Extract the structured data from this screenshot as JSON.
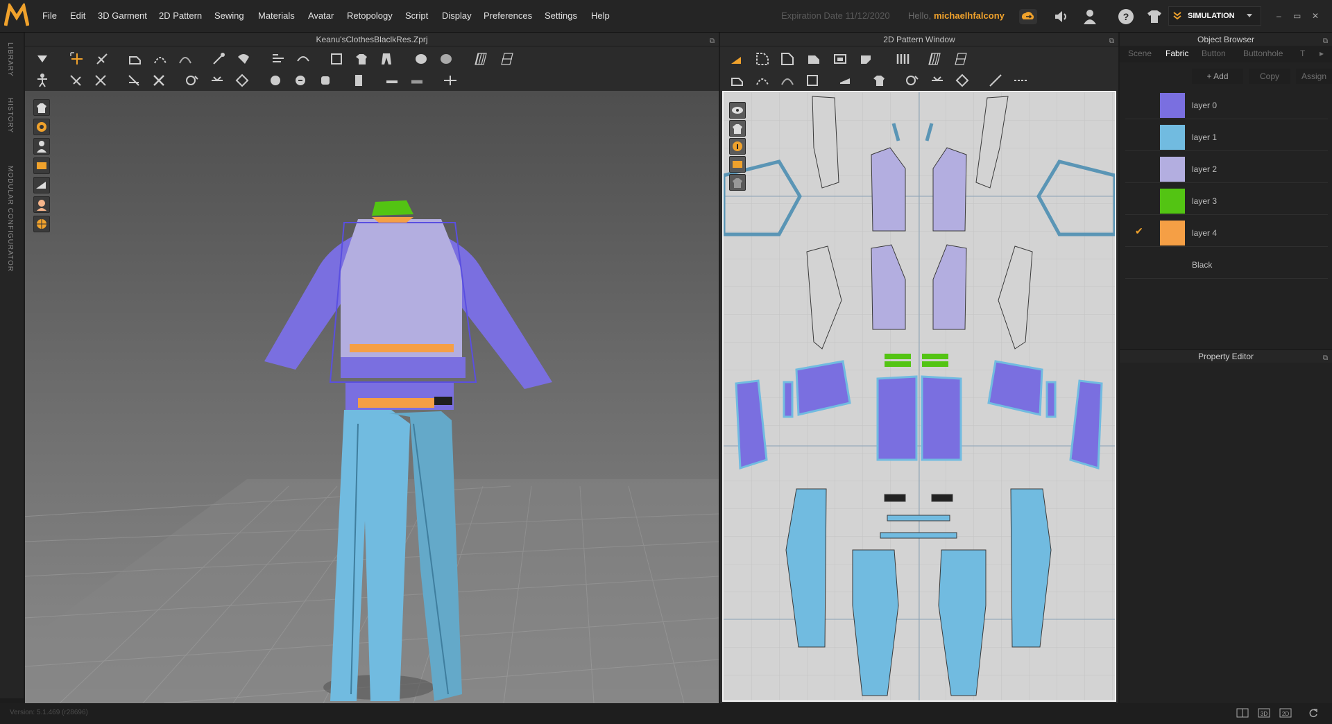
{
  "app": {
    "logo": "MD"
  },
  "menu": [
    "File",
    "Edit",
    "3D Garment",
    "2D Pattern",
    "Sewing",
    "Materials",
    "Avatar",
    "Retopology",
    "Script",
    "Display",
    "Preferences",
    "Settings",
    "Help"
  ],
  "header": {
    "expiry": "Expiration Date 11/12/2020",
    "hello": "Hello,",
    "username": "michaelhfalcony",
    "mode": "SIMULATION",
    "icons": [
      "cloud-icon",
      "speaker-icon",
      "user-icon",
      "help-icon",
      "shirt-icon"
    ]
  },
  "left_rail": [
    "LIBRARY",
    "HISTORY",
    "MODULAR CONFIGURATOR"
  ],
  "window3d": {
    "title": "Keanu'sClothesBlaclkRes.Zprj"
  },
  "window2d": {
    "title": "2D Pattern Window"
  },
  "object_browser": {
    "title": "Object Browser",
    "tabs": [
      "Scene",
      "Fabric",
      "Button",
      "Buttonhole",
      "T"
    ],
    "active_tab": "Fabric",
    "buttons": {
      "add": "+ Add",
      "copy": "Copy",
      "assign": "Assign"
    },
    "fabrics": [
      {
        "name": "layer 0",
        "color": "#7a6fe0",
        "checked": false
      },
      {
        "name": "layer 1",
        "color": "#71bbe0",
        "checked": false
      },
      {
        "name": "layer 2",
        "color": "#b3aee0",
        "checked": false
      },
      {
        "name": "layer 3",
        "color": "#53c413",
        "checked": false
      },
      {
        "name": "layer 4",
        "color": "#f59f45",
        "checked": true
      },
      {
        "name": "Black",
        "color": "#222222",
        "checked": false
      }
    ],
    "check_mark": "✔"
  },
  "property_editor": {
    "title": "Property Editor"
  },
  "status": {
    "version": "Version: 5.1.469 (r28696)"
  },
  "colors": {
    "accent": "#f0a22c",
    "pattern_bg": "#d3d3d3",
    "jacket": "#7a6fe0",
    "pants": "#71bbe0",
    "vest": "#b3aee0"
  }
}
